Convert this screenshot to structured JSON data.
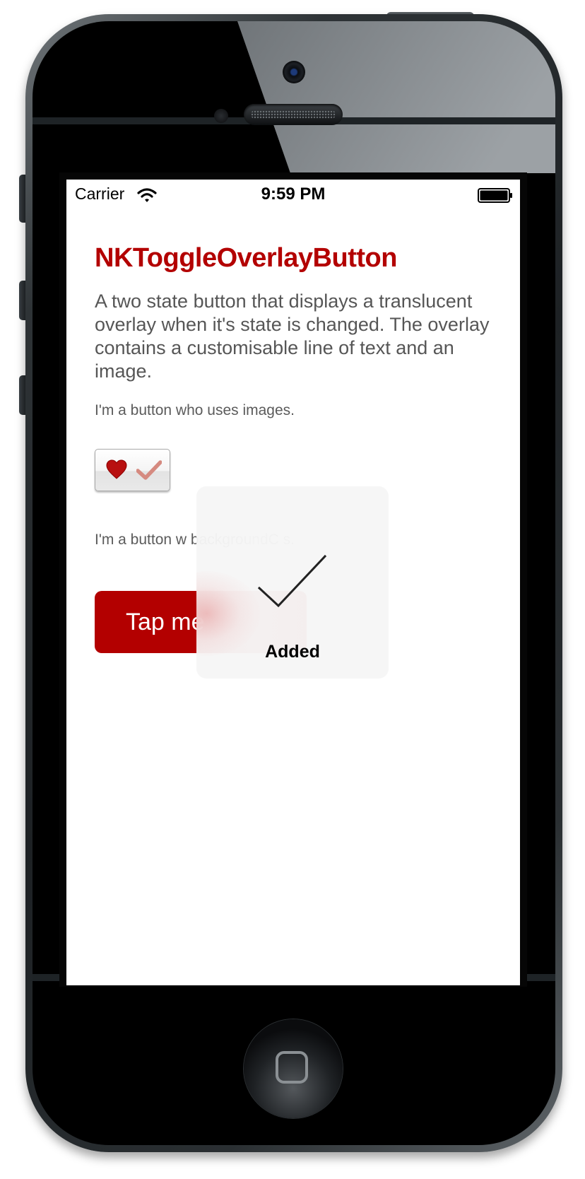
{
  "status_bar": {
    "carrier": "Carrier",
    "time": "9:59 PM",
    "icons": [
      "wifi-icon",
      "battery-icon"
    ]
  },
  "content": {
    "title": "NKToggleOverlayButton",
    "description": "A two state button that displays a translucent overlay when it's state is changed. The overlay contains a customisable line of text and an image.",
    "image_button_caption": "I'm a button who uses images.",
    "image_button_icons": [
      "heart-icon",
      "check-icon"
    ],
    "color_button_caption_visible": "I'm a button w backgroundC s.",
    "color_button_label_visible": "Tap me"
  },
  "overlay": {
    "label": "Added",
    "icon": "check-icon"
  },
  "colors": {
    "accent_red": "#b30000",
    "body_text": "#565656",
    "overlay_background": "#f6f6f6"
  }
}
